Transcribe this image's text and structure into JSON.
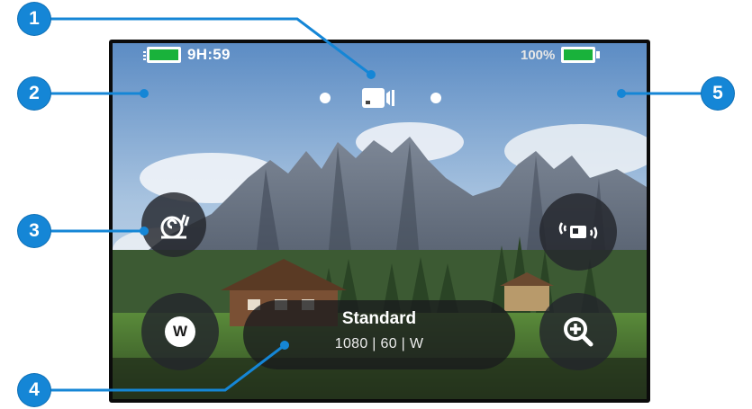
{
  "status_bar": {
    "remaining_time": "9H:59",
    "battery_percent": "100%",
    "mode_icon": "video-camera-icon",
    "storage_icon": "sd-card-icon",
    "battery_icon": "battery-icon"
  },
  "controls": {
    "slow_mo_icon": "snail-icon",
    "remote_icon": "camera-connect-icon",
    "lens_label": "W",
    "zoom_icon": "zoom-in-icon"
  },
  "preset": {
    "name": "Standard",
    "specs": "1080 | 60 | W"
  },
  "callouts": [
    "1",
    "2",
    "3",
    "4",
    "5"
  ],
  "colors": {
    "callout_blue": "#1586d6",
    "indicator_green": "#19b23b",
    "control_bg": "#23262c"
  }
}
